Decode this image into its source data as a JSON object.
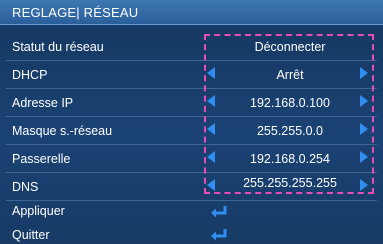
{
  "header": {
    "title": "REGLAGE| RÉSEAU"
  },
  "rows": [
    {
      "label": "Statut du réseau",
      "value": "Déconnecter"
    },
    {
      "label": "DHCP",
      "value": "Arrêt"
    },
    {
      "label": "Adresse IP",
      "value": "192.168.0.100"
    },
    {
      "label": "Masque s.-réseau",
      "value": "255.255.0.0"
    },
    {
      "label": "Passerelle",
      "value": "192.168.0.254"
    },
    {
      "label": "DNS",
      "value": "255.255.255.255"
    },
    {
      "label": "Appliquer"
    },
    {
      "label": "Quitter"
    }
  ],
  "colors": {
    "accent_arrow": "#2f8ef0",
    "selection_border": "#e64db5",
    "header": "#3f78b3"
  },
  "icons": {
    "value_decrement": "left-arrow-icon",
    "value_increment": "right-arrow-icon",
    "confirm": "enter-icon"
  }
}
